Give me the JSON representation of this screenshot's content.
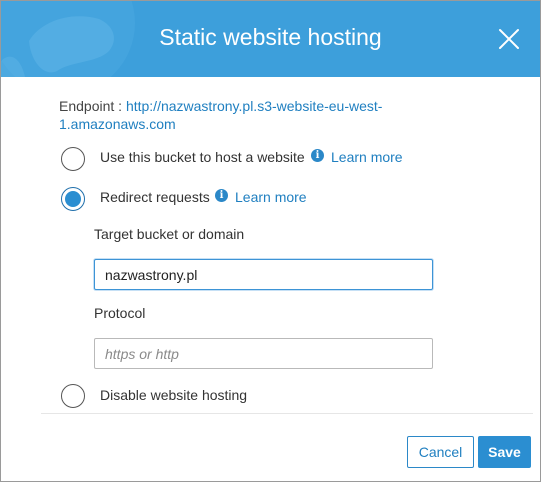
{
  "dialog": {
    "title": "Static website hosting"
  },
  "endpoint": {
    "label": "Endpoint : ",
    "url_line1": "http://nazwastrony.pl.s3-website-eu-west-",
    "url_line2": "1.amazonaws.com"
  },
  "options": {
    "host": {
      "label": "Use this bucket to host a website",
      "learn_more": "Learn more",
      "selected": false
    },
    "redirect": {
      "label": "Redirect requests",
      "learn_more": "Learn more",
      "selected": true
    },
    "disable": {
      "label": "Disable website hosting",
      "selected": false
    }
  },
  "redirect_form": {
    "target_label": "Target bucket or domain",
    "target_value": "nazwastrony.pl",
    "protocol_label": "Protocol",
    "protocol_placeholder": "https or http"
  },
  "footer": {
    "cancel_label": "Cancel",
    "save_label": "Save"
  },
  "colors": {
    "header": "#3d9fdb",
    "accent": "#2b8ed1",
    "link": "#1f7fc0"
  },
  "icons": {
    "close": "close-icon",
    "info": "info-icon"
  }
}
